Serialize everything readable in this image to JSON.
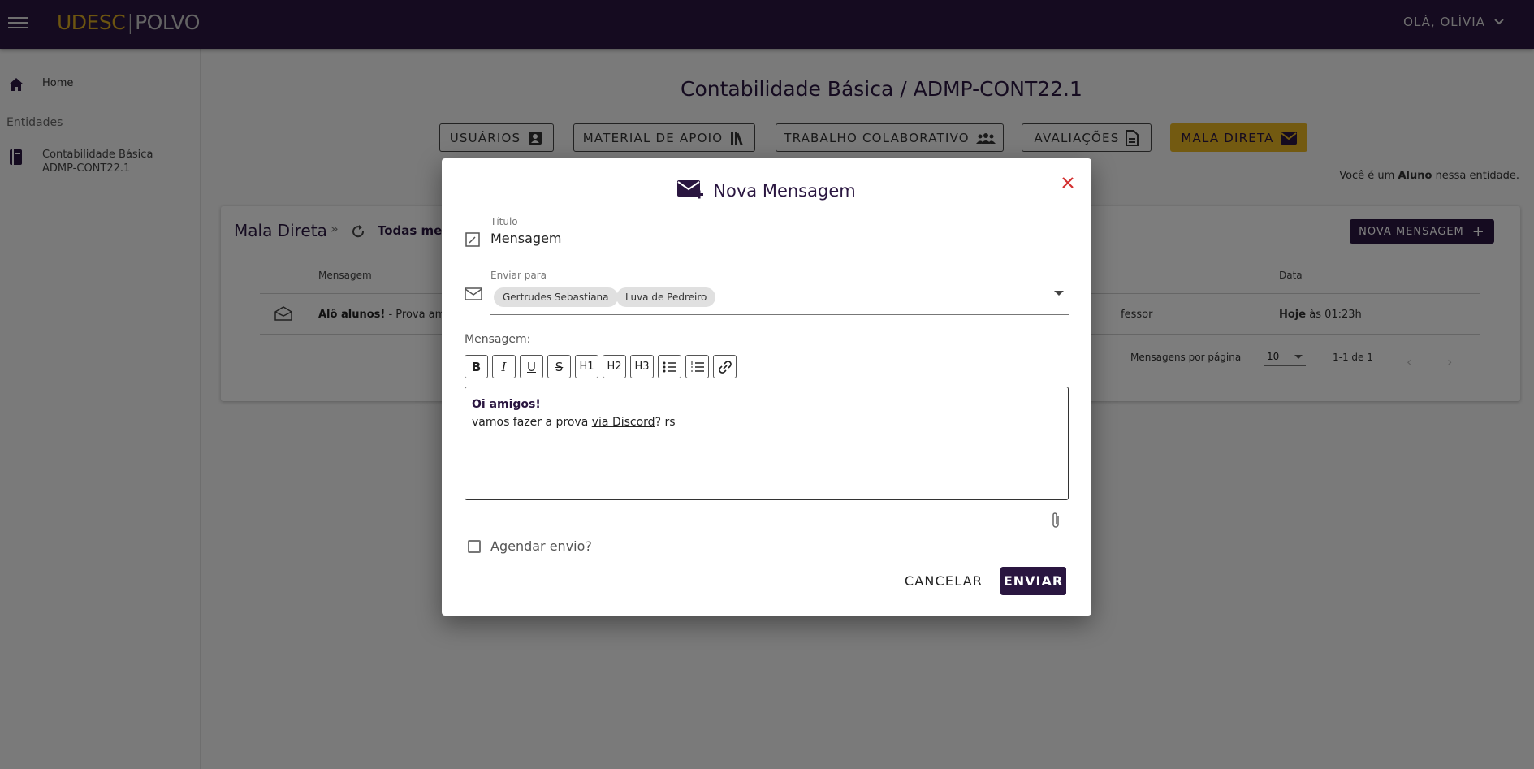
{
  "topbar": {
    "logo_left": "UDESC",
    "logo_sep": "|",
    "logo_right": "POLVO",
    "user_label": "OLÁ, OLÍVIA"
  },
  "sidebar": {
    "home_label": "Home",
    "section_label": "Entidades",
    "entity_name": "Contabilidade Básica",
    "entity_code": "ADMP-CONT22.1"
  },
  "main": {
    "page_title": "Contabilidade Básica / ADMP-CONT22.1",
    "tabs": [
      {
        "label": "USUÁRIOS",
        "icon": "user-list-icon"
      },
      {
        "label": "MATERIAL DE APOIO",
        "icon": "library-icon"
      },
      {
        "label": "TRABALHO COLABORATIVO",
        "icon": "group-icon"
      },
      {
        "label": "AVALIAÇÕES",
        "icon": "document-icon"
      },
      {
        "label": "MALA DIRETA",
        "icon": "mail-icon"
      }
    ],
    "role_note_prefix": "Você é um ",
    "role_note_role": "Aluno",
    "role_note_suffix": " nessa entidade."
  },
  "card": {
    "title": "Mala Direta",
    "crumb_sep": "»",
    "filter_label": "Todas mens",
    "new_message_label": "NOVA MENSAGEM",
    "col_message": "Mensagem",
    "col_date": "Data",
    "row_title": "Alô alunos!",
    "row_preview": " - Prova ama",
    "row_sender": "fessor",
    "row_date_bold": "Hoje",
    "row_date_rest": " às 01:23h",
    "per_page_label": "Mensagens por página",
    "per_page_value": "10",
    "range_label": "1-1 de 1"
  },
  "dialog": {
    "title": "Nova Mensagem",
    "title_field_label": "Título",
    "title_field_value": "Mensagem",
    "recipients_label": "Enviar para",
    "recipients": [
      "Gertrudes Sebastiana",
      "Luva de Pedreiro"
    ],
    "message_label": "Mensagem:",
    "toolbar": [
      "B",
      "I",
      "U",
      "S",
      "H1",
      "H2",
      "H3",
      "ul",
      "ol",
      "link"
    ],
    "body_line1": "Oi amigos!",
    "body_line2_pre": "vamos fazer a prova ",
    "body_line2_link": "via Discord",
    "body_line2_post": "? rs",
    "schedule_label": "Agendar envio?",
    "cancel_label": "CANCELAR",
    "send_label": "ENVIAR"
  },
  "colors": {
    "primary": "#2a1640",
    "accent": "#e6b422",
    "close": "#d32f2f"
  }
}
